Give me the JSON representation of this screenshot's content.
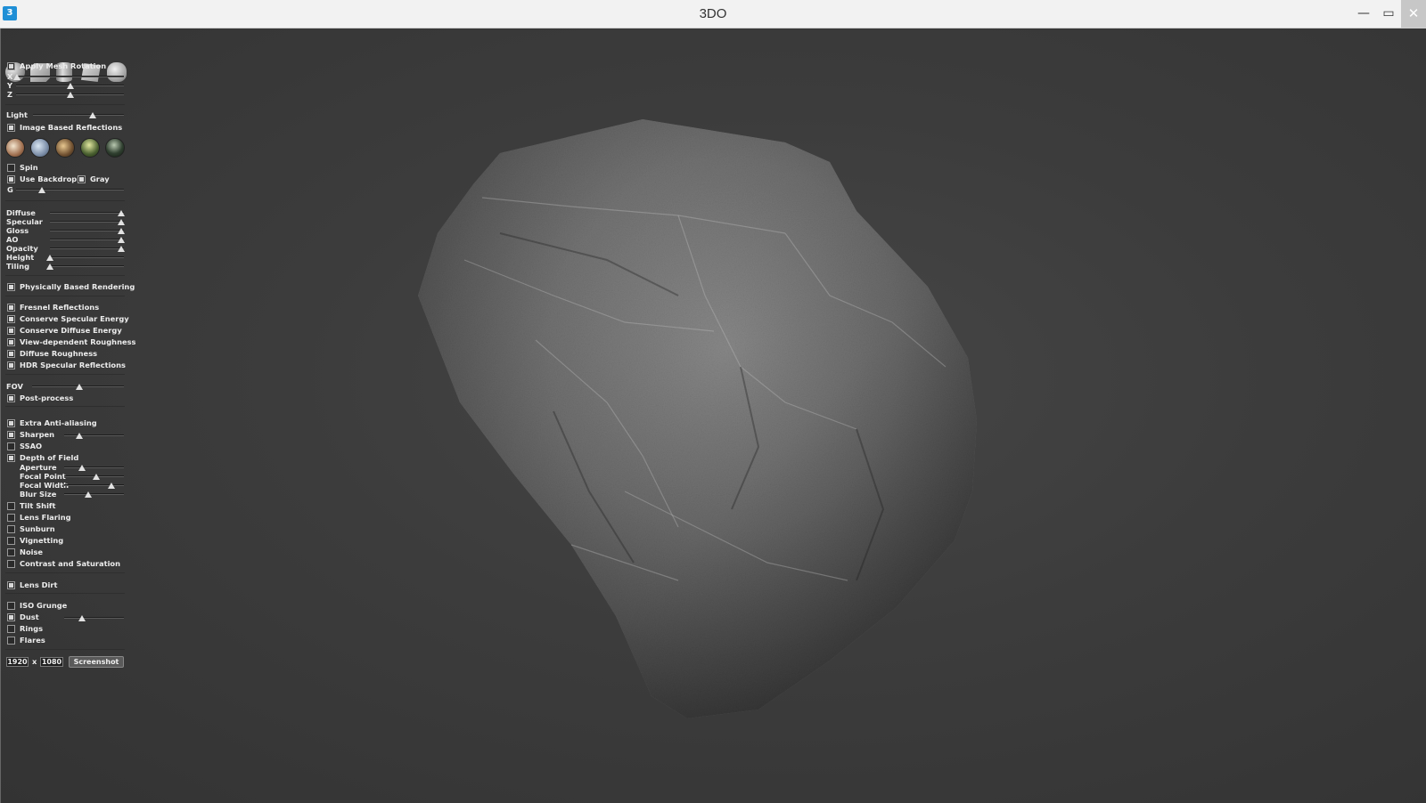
{
  "window": {
    "title": "3DO",
    "app_icon_glyph": "3",
    "minimize": "—",
    "maximize": "▭",
    "close": "✕"
  },
  "shapes": [
    "sphere-icon",
    "cube-icon",
    "cylinder-icon",
    "plane-icon",
    "head-icon"
  ],
  "mesh_rotation": {
    "label": "Apply Mesh Rotation",
    "checked": true,
    "x_label": "X",
    "y_label": "Y",
    "z_label": "Z",
    "x": 0.0,
    "y": 0.5,
    "z": 0.5
  },
  "light": {
    "label": "Light",
    "value": 0.65
  },
  "ibr": {
    "label": "Image Based Reflections",
    "checked": true,
    "envs": [
      "env-warm-sky",
      "env-cool-sky",
      "env-sunset",
      "env-forest",
      "env-night"
    ]
  },
  "spin": {
    "label": "Spin",
    "checked": false
  },
  "backdrop": {
    "label": "Use Backdrop",
    "checked": true,
    "gray_label": "Gray",
    "gray_checked": true,
    "g_label": "G",
    "g_value": 0.25
  },
  "material": [
    {
      "label": "Diffuse",
      "value": 1.0
    },
    {
      "label": "Specular",
      "value": 1.0
    },
    {
      "label": "Gloss",
      "value": 1.0
    },
    {
      "label": "AO",
      "value": 1.0
    },
    {
      "label": "Opacity",
      "value": 1.0
    },
    {
      "label": "Height",
      "value": 0.0
    },
    {
      "label": "Tiling",
      "value": 0.0
    }
  ],
  "pbr": {
    "label": "Physically Based Rendering",
    "checked": true
  },
  "pbr_options": [
    {
      "label": "Fresnel Reflections",
      "checked": true
    },
    {
      "label": "Conserve Specular Energy",
      "checked": true
    },
    {
      "label": "Conserve Diffuse Energy",
      "checked": true
    },
    {
      "label": "View-dependent Roughness",
      "checked": true
    },
    {
      "label": "Diffuse Roughness",
      "checked": true
    },
    {
      "label": "HDR Specular Reflections",
      "checked": true
    }
  ],
  "fov": {
    "label": "FOV",
    "value": 0.5
  },
  "postprocess": {
    "label": "Post-process",
    "checked": true
  },
  "post": {
    "extra_aa": {
      "label": "Extra Anti-aliasing",
      "checked": true
    },
    "sharpen": {
      "label": "Sharpen",
      "checked": true,
      "value": 0.25
    },
    "ssao": {
      "label": "SSAO",
      "checked": false
    },
    "dof": {
      "label": "Depth of Field",
      "checked": true
    },
    "dof_params": [
      {
        "label": "Aperture",
        "value": 0.3
      },
      {
        "label": "Focal Point",
        "value": 0.55
      },
      {
        "label": "Focal Width",
        "value": 0.8
      },
      {
        "label": "Blur Size",
        "value": 0.4
      }
    ],
    "effects": [
      {
        "label": "Tilt Shift",
        "checked": false
      },
      {
        "label": "Lens Flaring",
        "checked": false
      },
      {
        "label": "Sunburn",
        "checked": false
      },
      {
        "label": "Vignetting",
        "checked": false
      },
      {
        "label": "Noise",
        "checked": false
      },
      {
        "label": "Contrast and Saturation",
        "checked": false
      }
    ]
  },
  "lens_dirt": {
    "label": "Lens Dirt",
    "checked": true
  },
  "grunge": {
    "iso": {
      "label": "ISO Grunge",
      "checked": false
    },
    "dust": {
      "label": "Dust",
      "checked": true,
      "value": 0.3
    },
    "rings": {
      "label": "Rings",
      "checked": false
    },
    "flares": {
      "label": "Flares",
      "checked": false
    }
  },
  "screenshot": {
    "width": "1920",
    "x_label": "x",
    "height": "1080",
    "button": "Screenshot"
  }
}
